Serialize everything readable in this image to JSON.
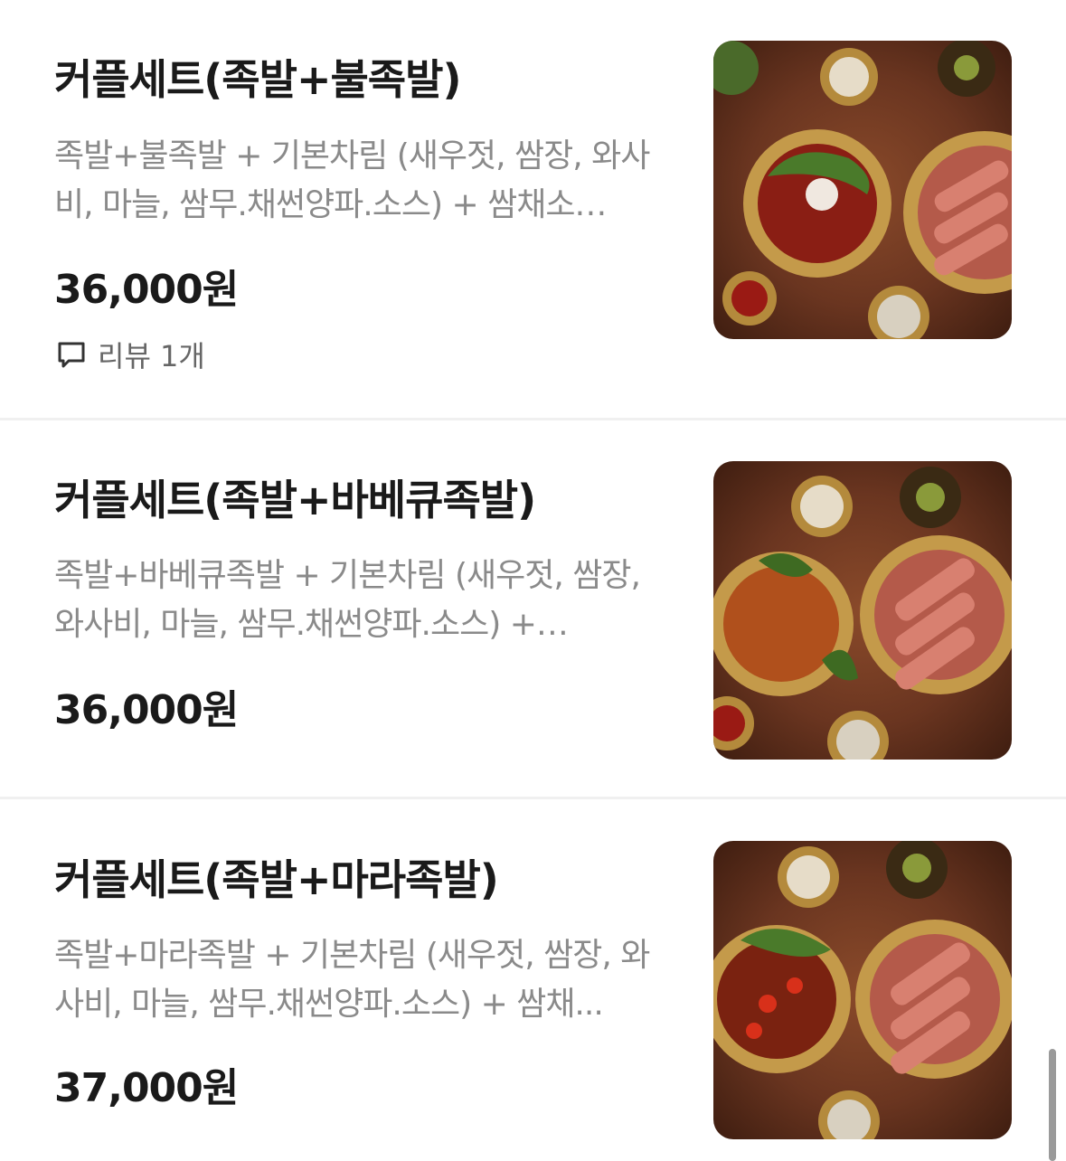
{
  "items": [
    {
      "title": "커플세트(족발+불족발)",
      "description": "족발+불족발 + 기본차림  (새우젓, 쌈장, 와사비, 마늘, 쌈무.채썬양파.소스) + 쌈채소…",
      "price": "36,000원",
      "review_label": "리뷰 1개",
      "image_icon": "food-photo-icon"
    },
    {
      "title": "커플세트(족발+바베큐족발)",
      "description": "족발+바베큐족발 + 기본차림  (새우젓, 쌈장, 와사비, 마늘, 쌈무.채썬양파.소스) +…",
      "price": "36,000원",
      "image_icon": "food-photo-icon"
    },
    {
      "title": "커플세트(족발+마라족발)",
      "description": "족발+마라족발 + 기본차림  (새우젓, 쌈장, 와사비, 마늘, 쌈무.채썬양파.소스) + 쌈채...",
      "price": "37,000원",
      "image_icon": "food-photo-icon"
    }
  ],
  "colors": {
    "title": "#1a1a1a",
    "description": "#8a8a8a",
    "divider": "#f0f0f0",
    "scrollbar": "#9a9a9a"
  }
}
